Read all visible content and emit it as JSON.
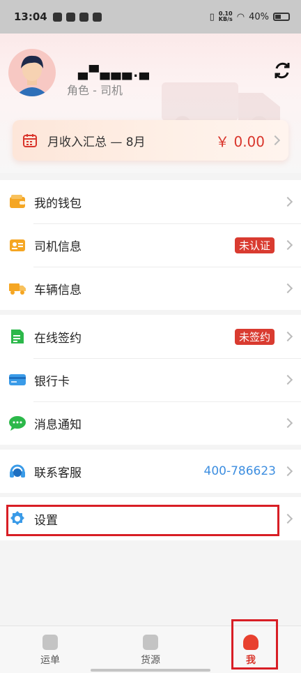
{
  "status_bar": {
    "time": "13:04",
    "net_speed_top": "0.10",
    "net_speed_bottom": "KB/s",
    "battery": "40%"
  },
  "profile": {
    "name": "▄▀▄▄▄.▄",
    "role": "角色 - 司机"
  },
  "income": {
    "label": "月收入汇总 — 8月",
    "amount": "￥ 0.00"
  },
  "groups": [
    [
      {
        "label": "我的钱包",
        "icon": "wallet-icon"
      },
      {
        "label": "司机信息",
        "icon": "id-card-icon",
        "badge": "未认证"
      },
      {
        "label": "车辆信息",
        "icon": "truck-icon"
      }
    ],
    [
      {
        "label": "在线签约",
        "icon": "contract-icon",
        "badge": "未签约"
      },
      {
        "label": "银行卡",
        "icon": "bank-card-icon"
      },
      {
        "label": "消息通知",
        "icon": "chat-icon"
      }
    ],
    [
      {
        "label": "联系客服",
        "icon": "headset-icon",
        "phone": "400-786623"
      }
    ],
    [
      {
        "label": "设置",
        "icon": "gear-icon"
      }
    ]
  ],
  "tabs": [
    {
      "label": "运单",
      "icon": "waybill-icon",
      "active": false
    },
    {
      "label": "货源",
      "icon": "cargo-icon",
      "active": false
    },
    {
      "label": "我",
      "icon": "user-icon",
      "active": true
    }
  ],
  "colors": {
    "accent": "#d9352b",
    "link": "#3d8ee0",
    "highlight": "#d81e25"
  }
}
